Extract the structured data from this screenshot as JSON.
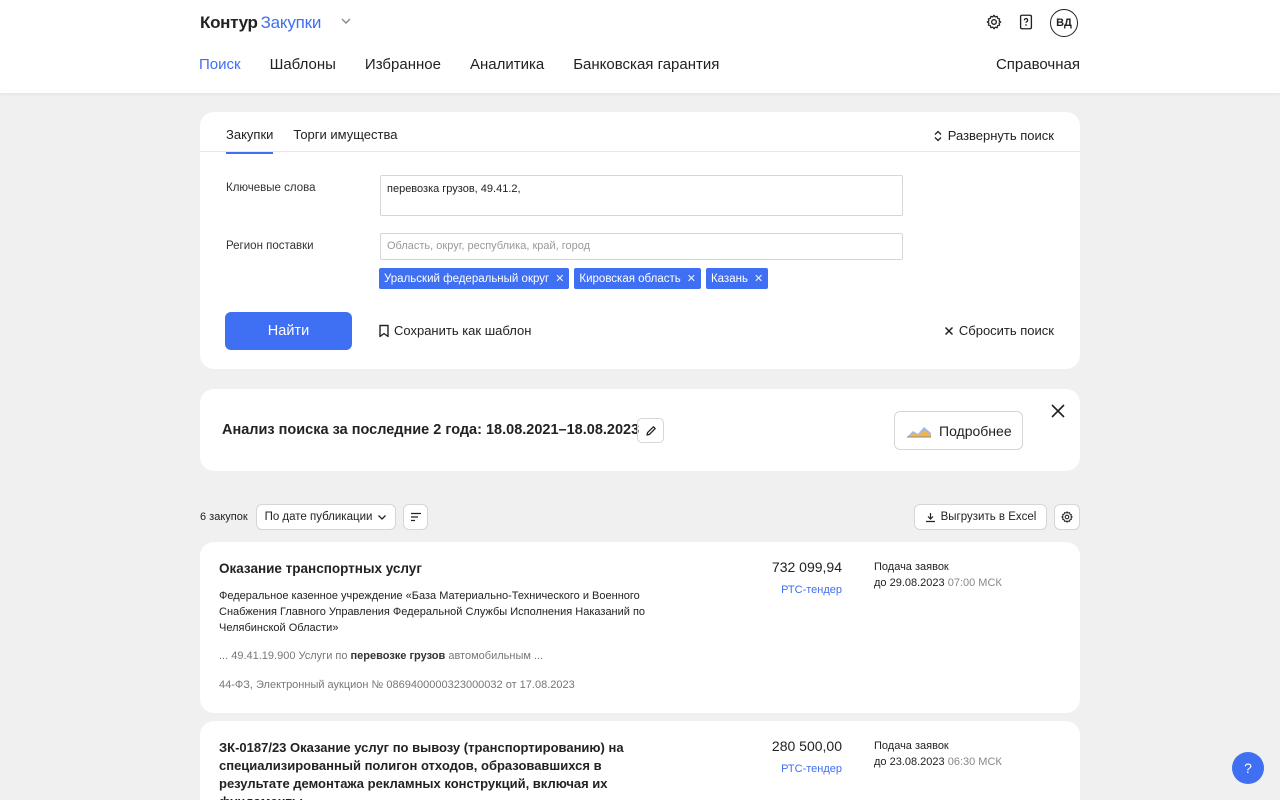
{
  "header": {
    "logo_main": "Контур",
    "logo_product": "Закупки",
    "avatar": "ВД",
    "nav": [
      "Поиск",
      "Шаблоны",
      "Избранное",
      "Аналитика",
      "Банковская гарантия"
    ],
    "nav_active_index": 0,
    "help_link": "Справочная"
  },
  "search": {
    "tabs": [
      "Закупки",
      "Торги имущества"
    ],
    "active_tab": 0,
    "expand_label": "Развернуть поиск",
    "keywords_label": "Ключевые слова",
    "keywords_value": "перевозка грузов, 49.41.2,",
    "region_label": "Регион поставки",
    "region_placeholder": "Область, округ, республика, край, город",
    "region_chips": [
      "Уральский федеральный округ",
      "Кировская область",
      "Казань"
    ],
    "find_label": "Найти",
    "save_template_label": "Сохранить как шаблон",
    "reset_label": "Сбросить поиск"
  },
  "analysis": {
    "title": "Анализ поиска за последние 2 года: 18.08.2021–18.08.2023",
    "more_label": "Подробнее"
  },
  "results": {
    "count_label": "6 закупок",
    "sort_label": "По дате публикации",
    "excel_label": "Выгрузить в Excel",
    "items": [
      {
        "title": "Оказание транспортных услуг",
        "org": "Федеральное казенное учреждение «База Материально-Технического и Военного Снабжения Главного Управления Федеральной Службы Исполнения Наказаний по Челябинской Области»",
        "snippet_pre": "... 49.41.19.900 Услуги по ",
        "snippet_bold": "перевозке грузов",
        "snippet_post": " автомобильным ...",
        "law": "44-ФЗ, Электронный аукцион № 0869400000323000032 от 17.08.2023",
        "price": "732 099,94",
        "platform": "РТС-тендер",
        "deadline_label": "Подача заявок",
        "deadline_date": "до 29.08.2023",
        "deadline_time": "07:00 МСК"
      },
      {
        "title": "ЗК-0187/23 Оказание услуг по вывозу (транспортированию) на специализированный полигон отходов, образовавшихся в результате демонтажа рекламных конструкций, включая их фундаменты",
        "price": "280 500,00",
        "platform": "РТС-тендер",
        "deadline_label": "Подача заявок",
        "deadline_date": "до 23.08.2023",
        "deadline_time": "06:30 МСК"
      }
    ]
  },
  "help_button": "?"
}
